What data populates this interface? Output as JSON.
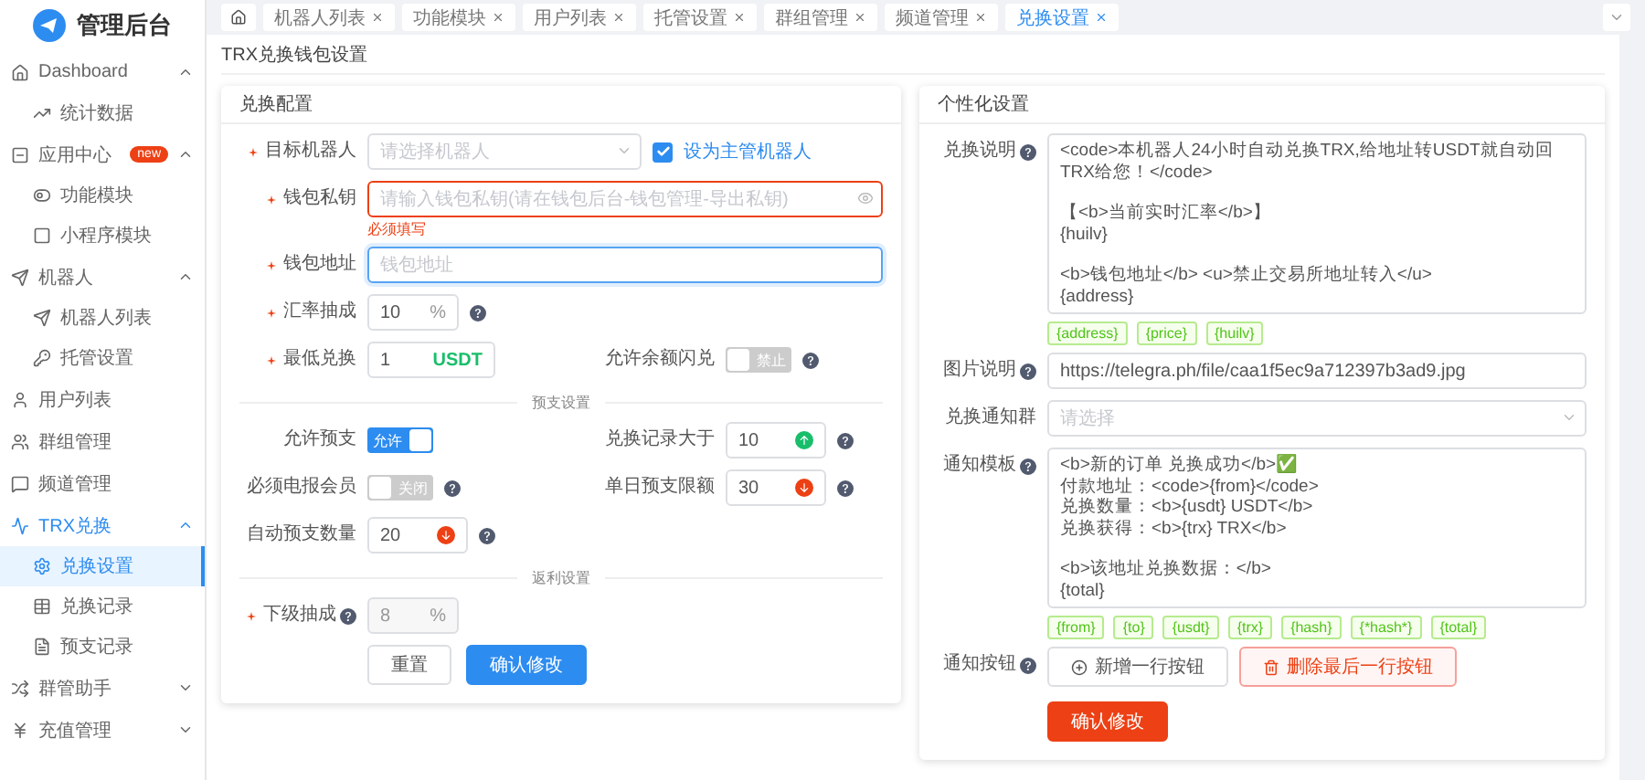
{
  "sidebar": {
    "logo": "管理后台",
    "items": [
      {
        "label": "Dashboard",
        "expanded": true,
        "selected": false,
        "children": [
          {
            "label": "统计数据",
            "selected": false
          }
        ]
      },
      {
        "label": "应用中心",
        "badge": "new",
        "expanded": true,
        "selected": false,
        "children": [
          {
            "label": "功能模块",
            "selected": false
          },
          {
            "label": "小程序模块",
            "selected": false
          }
        ]
      },
      {
        "label": "机器人",
        "expanded": true,
        "selected": false,
        "children": [
          {
            "label": "机器人列表",
            "selected": false
          },
          {
            "label": "托管设置",
            "selected": false
          }
        ]
      },
      {
        "label": "用户列表",
        "selected": false
      },
      {
        "label": "群组管理",
        "selected": false
      },
      {
        "label": "频道管理",
        "selected": false
      },
      {
        "label": "TRX兑换",
        "expanded": true,
        "selected": true,
        "children": [
          {
            "label": "兑换设置",
            "selected": true
          },
          {
            "label": "兑换记录",
            "selected": false
          },
          {
            "label": "预支记录",
            "selected": false
          }
        ]
      },
      {
        "label": "群管助手",
        "expanded": false,
        "selected": false
      },
      {
        "label": "充值管理",
        "expanded": false,
        "selected": false
      }
    ]
  },
  "tabs": [
    {
      "label": "机器人列表",
      "selected": false
    },
    {
      "label": "功能模块",
      "selected": false
    },
    {
      "label": "用户列表",
      "selected": false
    },
    {
      "label": "托管设置",
      "selected": false
    },
    {
      "label": "群组管理",
      "selected": false
    },
    {
      "label": "频道管理",
      "selected": false
    },
    {
      "label": "兑换设置",
      "selected": true
    }
  ],
  "page_title": "TRX兑换钱包设置",
  "exchange_config": {
    "title": "兑换配置",
    "rows": [
      {
        "kind": "fields",
        "fields": [
          {
            "kind": "select",
            "label": "目标机器人",
            "required": true,
            "placeholder": "请选择机器人",
            "checkbox": {
              "label": "设为主管机器人",
              "checked": true
            }
          }
        ]
      },
      {
        "kind": "fields",
        "fields": [
          {
            "kind": "text",
            "label": "钱包私钥",
            "required": true,
            "placeholder": "请输入钱包私钥(请在钱包后台-钱包管理-导出私钥)",
            "invalid": true,
            "error": "必须填写"
          }
        ]
      },
      {
        "kind": "fields",
        "fields": [
          {
            "kind": "text",
            "label": "钱包地址",
            "required": true,
            "placeholder": "钱包地址",
            "invalid": false,
            "focused": true
          }
        ]
      },
      {
        "kind": "fields",
        "fields": [
          {
            "kind": "number",
            "label": "汇率抽成",
            "required": true,
            "value": "10",
            "unit": "%",
            "help": true
          }
        ]
      },
      {
        "kind": "fields",
        "fields": [
          {
            "kind": "currency",
            "label": "最低兑换",
            "required": true,
            "value": "1",
            "unit": "USDT"
          },
          {
            "kind": "switch",
            "label": "允许余额闪兑",
            "on": false,
            "text": "禁止",
            "help": true
          }
        ]
      },
      {
        "kind": "divider",
        "label": "预支设置"
      },
      {
        "kind": "fields",
        "fields": [
          {
            "kind": "switch",
            "label": "允许预支",
            "on": true,
            "text": "允许"
          },
          {
            "kind": "stepper",
            "label": "兑换记录大于",
            "value": "10",
            "rising": true,
            "help": true
          }
        ]
      },
      {
        "kind": "fields",
        "fields": [
          {
            "kind": "switch",
            "label": "必须电报会员",
            "on": false,
            "text": "关闭",
            "help": true
          },
          {
            "kind": "stepper",
            "label": "单日预支限额",
            "value": "30",
            "rising": false,
            "help": true
          }
        ]
      },
      {
        "kind": "fields",
        "fields": [
          {
            "kind": "stepper",
            "label": "自动预支数量",
            "value": "20",
            "rising": false,
            "help": true
          }
        ]
      },
      {
        "kind": "divider",
        "label": "返利设置"
      },
      {
        "kind": "fields",
        "fields": [
          {
            "kind": "number",
            "label": "下级抽成",
            "required": true,
            "label_help": true,
            "value": "8",
            "unit": "%",
            "disabled": true
          }
        ]
      }
    ],
    "buttons": [
      {
        "label": "重置",
        "kind": "plain"
      },
      {
        "label": "确认修改",
        "kind": "primary"
      }
    ]
  },
  "custom_settings": {
    "title": "个性化设置",
    "rows": [
      {
        "kind": "textarea",
        "label": "兑换说明",
        "help": true,
        "paragraphs": [
          [
            "<code>本机器人24小时自动兑换TRX,给地址转USDT就自动回TRX给您！</code>"
          ],
          [
            "【<b>当前实时汇率</b>】",
            "{huilv}"
          ],
          [
            "<b>钱包地址</b> <u>禁止交易所地址转入</u>",
            "{address}"
          ]
        ],
        "tags": [
          "{address}",
          "{price}",
          "{huilv}"
        ]
      },
      {
        "kind": "input",
        "label": "图片说明",
        "help": true,
        "value": "https://telegra.ph/file/caa1f5ec9a712397b3ad9.jpg"
      },
      {
        "kind": "select",
        "label": "兑换通知群",
        "placeholder": "请选择"
      },
      {
        "kind": "textarea",
        "label": "通知模板",
        "help": true,
        "paragraphs": [
          [
            "<b>新的订单 兑换成功</b>✅",
            "付款地址：<code>{from}</code>",
            "兑换数量：<b>{usdt} USDT</b>",
            "兑换获得：<b>{trx} TRX</b>"
          ],
          [
            "<b>该地址兑换数据：</b>",
            "{total}"
          ]
        ],
        "tags": [
          "{from}",
          "{to}",
          "{usdt}",
          "{trx}",
          "{hash}",
          "{*hash*}",
          "{total}"
        ]
      },
      {
        "kind": "buttons",
        "label": "通知按钮",
        "help": true,
        "buttons": [
          {
            "label": "新增一行按钮",
            "kind": "add"
          },
          {
            "label": "删除最后一行按钮",
            "kind": "delete"
          }
        ]
      }
    ],
    "submit": "确认修改"
  }
}
